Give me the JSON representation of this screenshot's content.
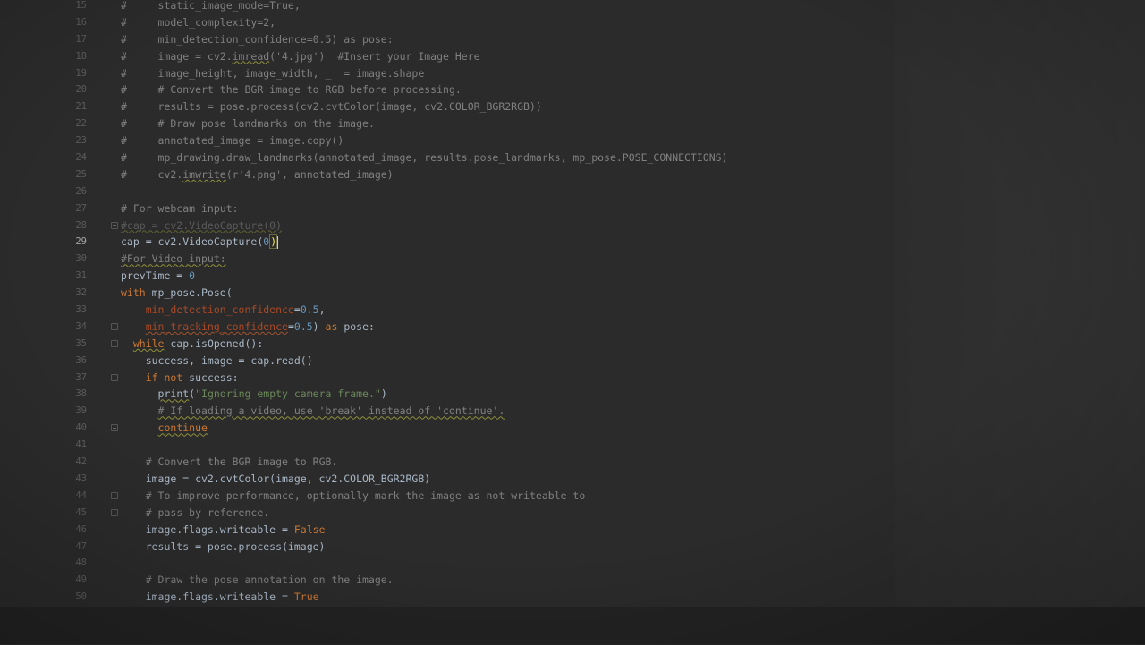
{
  "editor": {
    "language": "python",
    "current_line": "29",
    "lines": [
      {
        "n": "15",
        "segs": [
          {
            "t": "#     static_image_mode=True,",
            "c": "cm"
          }
        ]
      },
      {
        "n": "16",
        "segs": [
          {
            "t": "#     model_complexity=2,",
            "c": "cm"
          }
        ]
      },
      {
        "n": "17",
        "segs": [
          {
            "t": "#     min_detection_confidence=0.5) as pose:",
            "c": "cm"
          }
        ]
      },
      {
        "n": "18",
        "segs": [
          {
            "t": "#     image = cv2.",
            "c": "cm"
          },
          {
            "t": "imread",
            "c": "cm warn"
          },
          {
            "t": "('4.jpg')  #Insert your Image Here",
            "c": "cm"
          }
        ]
      },
      {
        "n": "19",
        "segs": [
          {
            "t": "#     image_height, image_width, _  = image.shape",
            "c": "cm"
          }
        ]
      },
      {
        "n": "20",
        "segs": [
          {
            "t": "#     # Convert the BGR image to RGB before processing.",
            "c": "cm"
          }
        ]
      },
      {
        "n": "21",
        "segs": [
          {
            "t": "#     results = pose.process(cv2.cvtColor(image, cv2.COLOR_BGR2RGB))",
            "c": "cm"
          }
        ]
      },
      {
        "n": "22",
        "segs": [
          {
            "t": "#     # Draw pose landmarks on the image.",
            "c": "cm"
          }
        ]
      },
      {
        "n": "23",
        "segs": [
          {
            "t": "#     annotated_image = image.copy()",
            "c": "cm"
          }
        ]
      },
      {
        "n": "24",
        "segs": [
          {
            "t": "#     mp_drawing.draw_landmarks(annotated_image, results.pose_landmarks, mp_pose.POSE_CONNECTIONS)",
            "c": "cm"
          }
        ]
      },
      {
        "n": "25",
        "segs": [
          {
            "t": "#     cv2.",
            "c": "cm"
          },
          {
            "t": "imwrite",
            "c": "cm warn"
          },
          {
            "t": "(r'4.png', annotated_image)",
            "c": "cm"
          }
        ]
      },
      {
        "n": "26",
        "segs": [
          {
            "t": "",
            "c": ""
          }
        ]
      },
      {
        "n": "27",
        "segs": [
          {
            "t": "# For webcam input:",
            "c": "cm"
          }
        ]
      },
      {
        "n": "28",
        "fold": true,
        "segs": [
          {
            "t": "#cap = cv2.VideoCapture(0)",
            "c": "cm warn dim"
          }
        ]
      },
      {
        "n": "29",
        "segs": [
          {
            "t": "cap = cv2.VideoCapture(",
            "c": ""
          },
          {
            "t": "0",
            "c": "num"
          },
          {
            "t": ")",
            "c": "caret-bracket"
          },
          {
            "t": "",
            "c": "caret"
          }
        ]
      },
      {
        "n": "30",
        "segs": [
          {
            "t": "#For Video input:",
            "c": "cm warn"
          }
        ]
      },
      {
        "n": "31",
        "segs": [
          {
            "t": "prevTime = ",
            "c": ""
          },
          {
            "t": "0",
            "c": "num"
          }
        ]
      },
      {
        "n": "32",
        "segs": [
          {
            "t": "with ",
            "c": "kw"
          },
          {
            "t": "mp_pose.Pose(",
            "c": ""
          }
        ]
      },
      {
        "n": "33",
        "segs": [
          {
            "t": "    ",
            "c": ""
          },
          {
            "t": "min_detection_confidence",
            "c": "prm"
          },
          {
            "t": "=",
            "c": ""
          },
          {
            "t": "0.5",
            "c": "num"
          },
          {
            "t": ",",
            "c": ""
          }
        ]
      },
      {
        "n": "34",
        "fold": true,
        "segs": [
          {
            "t": "    ",
            "c": ""
          },
          {
            "t": "min_tracking_confidence",
            "c": "prm err"
          },
          {
            "t": "=",
            "c": ""
          },
          {
            "t": "0.5",
            "c": "num"
          },
          {
            "t": ") ",
            "c": ""
          },
          {
            "t": "as ",
            "c": "kw"
          },
          {
            "t": "pose:",
            "c": ""
          }
        ]
      },
      {
        "n": "35",
        "fold": true,
        "segs": [
          {
            "t": "  ",
            "c": ""
          },
          {
            "t": "while",
            "c": "kw warn"
          },
          {
            "t": " cap.isOpened():",
            "c": ""
          }
        ]
      },
      {
        "n": "36",
        "segs": [
          {
            "t": "    success, image = cap.read()",
            "c": ""
          }
        ]
      },
      {
        "n": "37",
        "fold": true,
        "segs": [
          {
            "t": "    ",
            "c": ""
          },
          {
            "t": "if not ",
            "c": "kw"
          },
          {
            "t": "success:",
            "c": ""
          }
        ]
      },
      {
        "n": "38",
        "segs": [
          {
            "t": "      ",
            "c": ""
          },
          {
            "t": "print",
            "c": "warn"
          },
          {
            "t": "(",
            "c": ""
          },
          {
            "t": "\"Ignoring empty camera frame.\"",
            "c": "str"
          },
          {
            "t": ")",
            "c": ""
          }
        ]
      },
      {
        "n": "39",
        "segs": [
          {
            "t": "      ",
            "c": ""
          },
          {
            "t": "# If loading a video, use 'break' instead of 'continue'.",
            "c": "cm warn"
          }
        ]
      },
      {
        "n": "40",
        "fold": true,
        "segs": [
          {
            "t": "      ",
            "c": ""
          },
          {
            "t": "continue",
            "c": "kw warn"
          }
        ]
      },
      {
        "n": "41",
        "segs": [
          {
            "t": "",
            "c": ""
          }
        ]
      },
      {
        "n": "42",
        "segs": [
          {
            "t": "    ",
            "c": ""
          },
          {
            "t": "# Convert the BGR image to RGB.",
            "c": "cm"
          }
        ]
      },
      {
        "n": "43",
        "segs": [
          {
            "t": "    image = cv2.cvtColor(image, cv2.COLOR_BGR2RGB)",
            "c": ""
          }
        ]
      },
      {
        "n": "44",
        "fold": true,
        "segs": [
          {
            "t": "    ",
            "c": ""
          },
          {
            "t": "# To improve performance, optionally mark the image as not writeable to",
            "c": "cm"
          }
        ]
      },
      {
        "n": "45",
        "fold": true,
        "segs": [
          {
            "t": "    ",
            "c": ""
          },
          {
            "t": "# pass by reference.",
            "c": "cm"
          }
        ]
      },
      {
        "n": "46",
        "segs": [
          {
            "t": "    image.flags.writeable = ",
            "c": ""
          },
          {
            "t": "False",
            "c": "kw"
          }
        ]
      },
      {
        "n": "47",
        "segs": [
          {
            "t": "    results = pose.process(image)",
            "c": ""
          }
        ]
      },
      {
        "n": "48",
        "segs": [
          {
            "t": "",
            "c": ""
          }
        ]
      },
      {
        "n": "49",
        "segs": [
          {
            "t": "    ",
            "c": ""
          },
          {
            "t": "# Draw the pose annotation on the image.",
            "c": "cm"
          }
        ]
      },
      {
        "n": "50",
        "segs": [
          {
            "t": "    image.flags.writeable = ",
            "c": ""
          },
          {
            "t": "True",
            "c": "kw"
          }
        ]
      }
    ]
  },
  "colors": {
    "background": "#2b2b2b",
    "comment": "#808080",
    "keyword": "#cc7832",
    "number": "#6897bb",
    "string": "#6a8759",
    "parameter": "#aa4926",
    "default_text": "#a9b7c6"
  }
}
